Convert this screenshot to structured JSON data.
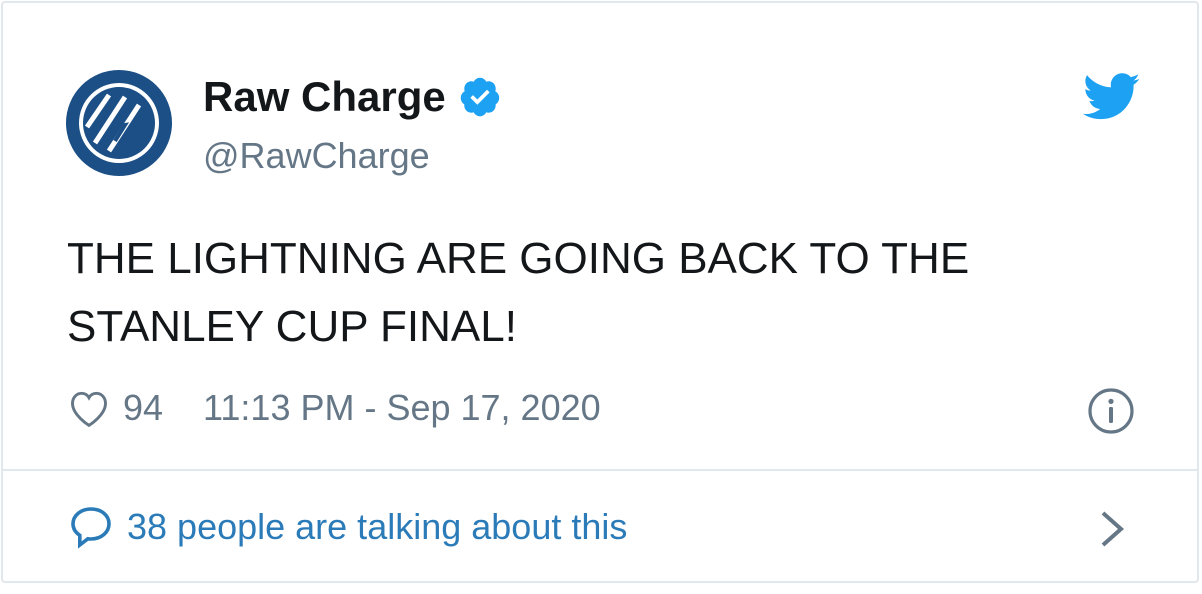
{
  "author": {
    "display_name": "Raw Charge",
    "handle": "@RawCharge",
    "avatar_icon": "raw-charge-logo-icon",
    "verified_icon": "verified-badge-icon"
  },
  "tweet": {
    "text": "THE LIGHTNING ARE GOING BACK TO THE STANLEY CUP FINAL!"
  },
  "meta": {
    "likes": "94",
    "timestamp": "11:13 PM - Sep 17, 2020"
  },
  "footer": {
    "talking_text": "38 people are talking about this"
  },
  "colors": {
    "twitter_blue": "#1da1f2",
    "link_blue": "#2b7bb9",
    "text_dark": "#14171a",
    "text_gray": "#657786",
    "border": "#e1e8ed",
    "avatar_navy": "#1b4f86"
  }
}
